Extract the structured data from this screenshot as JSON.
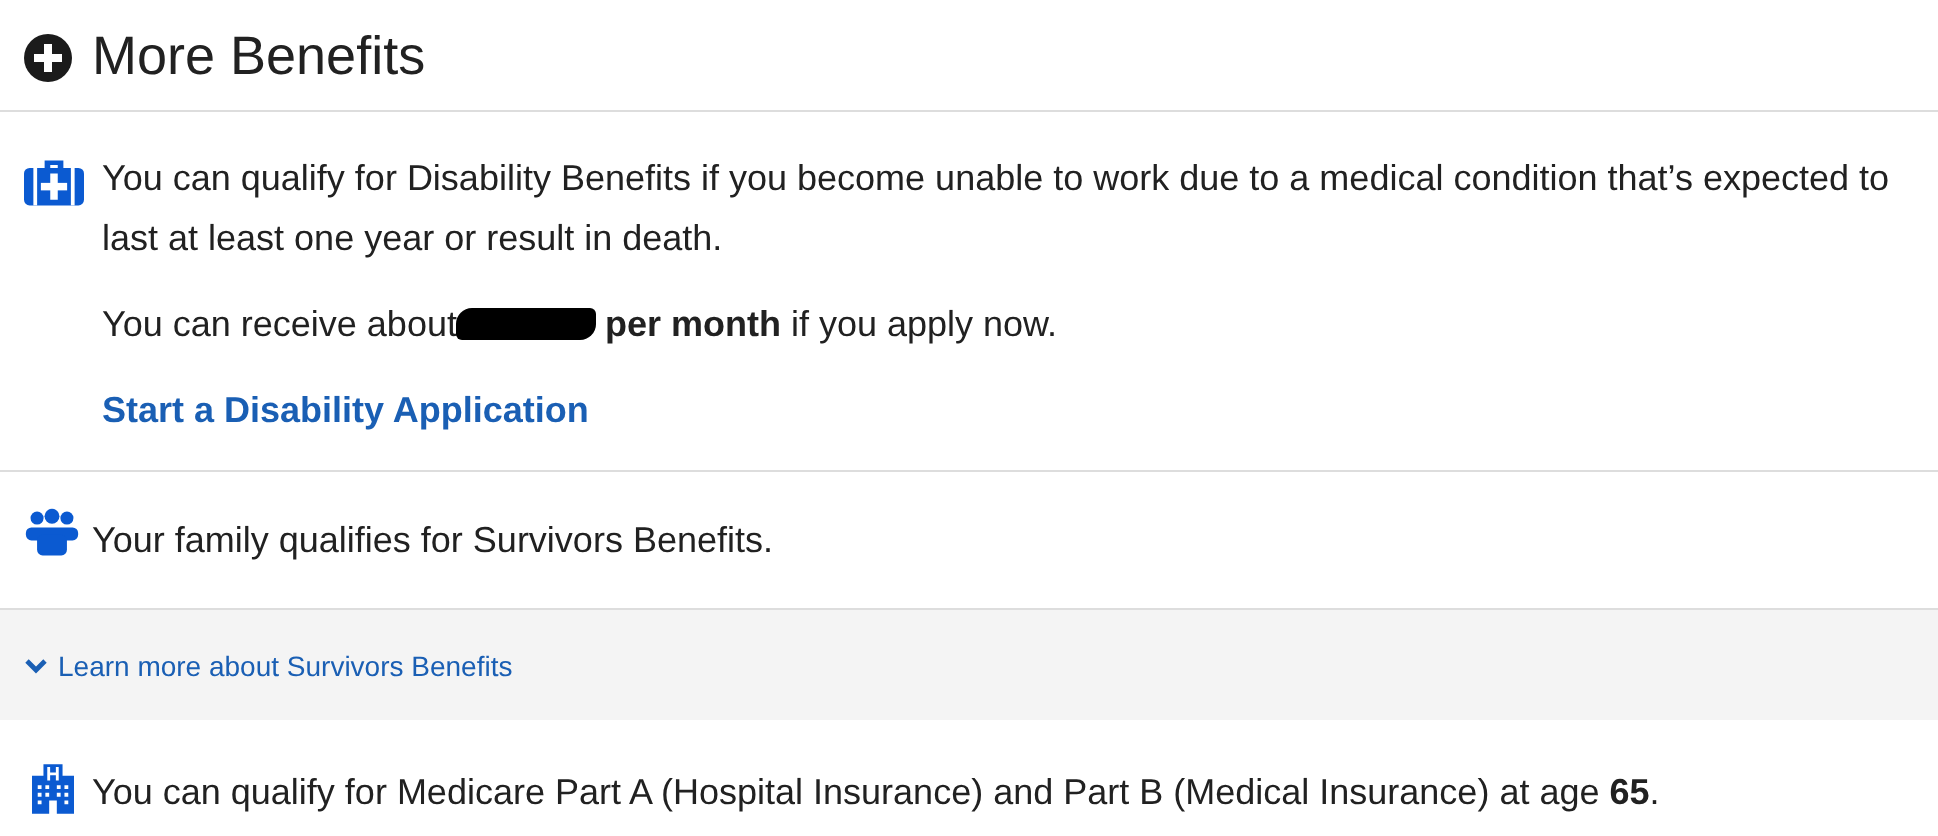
{
  "header": {
    "title": "More Benefits"
  },
  "disability": {
    "text": "You can qualify for Disability Benefits if you become unable to work due to a medical condition that’s expected to last at least one year or result in death.",
    "estimate_before": "You can receive about",
    "redacted": true,
    "estimate_after": "**per month** if you apply now.",
    "link": "Start a Disability Application"
  },
  "survivors": {
    "text": "Your family qualifies for Survivors Benefits.",
    "toggle": {
      "label": "Learn more about Survivors Benefits",
      "expanded": false
    }
  },
  "medicare": {
    "text": "You can qualify for Medicare Part A (Hospital Insurance) and Part B (Medical Insurance) at age **65**."
  }
}
